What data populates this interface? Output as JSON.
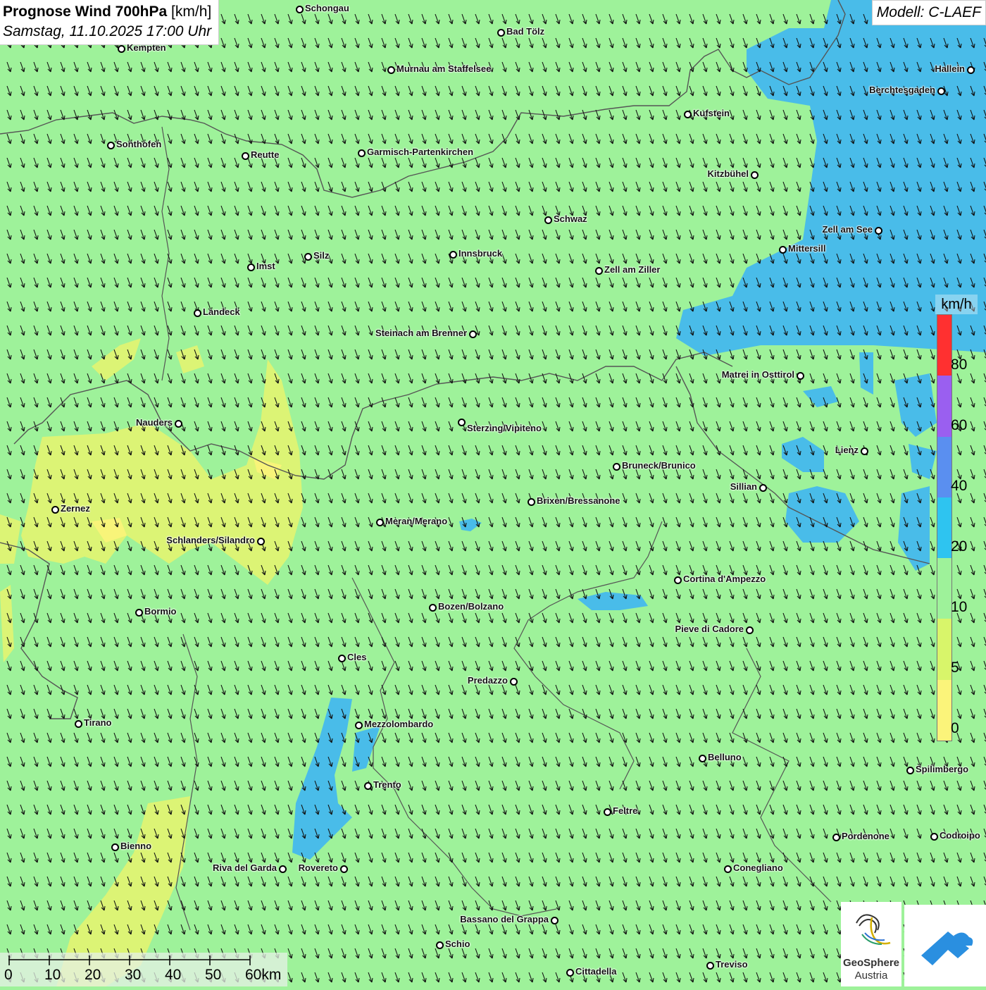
{
  "header": {
    "title_bold": "Prognose Wind 700hPa",
    "title_unit": " [km/h]",
    "datetime": "Samstag, 11.10.2025 17:00 Uhr",
    "model": "Modell: C-LAEF"
  },
  "legend": {
    "unit": "km/h",
    "labels": [
      "80",
      "60",
      "40",
      "20",
      "10",
      "5",
      "0"
    ],
    "colors": [
      "#ff3030",
      "#9a5ff0",
      "#5a8ff0",
      "#2ec4f0",
      "#9ef29a",
      "#d8f56a",
      "#fbf47a"
    ]
  },
  "scale_bar": {
    "labels": [
      "0",
      "10",
      "20",
      "30",
      "40",
      "50",
      "60km"
    ]
  },
  "logo": {
    "line1": "GeoSphere",
    "line2": "Austria"
  },
  "cities": [
    {
      "name": "Schongau"
    },
    {
      "name": "Bad Tölz"
    },
    {
      "name": "Kempten"
    },
    {
      "name": "Murnau am Staffelsee"
    },
    {
      "name": "Hallein"
    },
    {
      "name": "Berchtesgaden"
    },
    {
      "name": "Kufstein"
    },
    {
      "name": "Sonthofen"
    },
    {
      "name": "Reutte"
    },
    {
      "name": "Garmisch-Partenkirchen"
    },
    {
      "name": "Kitzbühel"
    },
    {
      "name": "Schwaz"
    },
    {
      "name": "Zell am See"
    },
    {
      "name": "Mittersill"
    },
    {
      "name": "Innsbruck"
    },
    {
      "name": "Silz"
    },
    {
      "name": "Imst"
    },
    {
      "name": "Zell am Ziller"
    },
    {
      "name": "Landeck"
    },
    {
      "name": "Steinach am Brenner"
    },
    {
      "name": "Matrei in Osttirol"
    },
    {
      "name": "Nauders"
    },
    {
      "name": "Sterzing/Vipiteno"
    },
    {
      "name": "Lienz"
    },
    {
      "name": "Bruneck/Brunico"
    },
    {
      "name": "Sillian"
    },
    {
      "name": "Zernez"
    },
    {
      "name": "Brixen/Bressanone"
    },
    {
      "name": "Meran/Merano"
    },
    {
      "name": "Schlanders/Silandro"
    },
    {
      "name": "Cortina d'Ampezzo"
    },
    {
      "name": "Bozen/Bolzano"
    },
    {
      "name": "Bormio"
    },
    {
      "name": "Pieve di Cadore"
    },
    {
      "name": "Cles"
    },
    {
      "name": "Predazzo"
    },
    {
      "name": "Tirano"
    },
    {
      "name": "Mezzolombardo"
    },
    {
      "name": "Belluno"
    },
    {
      "name": "Spilimbergo"
    },
    {
      "name": "Trento"
    },
    {
      "name": "Feltre"
    },
    {
      "name": "Pordenone"
    },
    {
      "name": "Codroipo"
    },
    {
      "name": "Bienno"
    },
    {
      "name": "Riva del Garda"
    },
    {
      "name": "Rovereto"
    },
    {
      "name": "Conegliano"
    },
    {
      "name": "Bassano del Grappa"
    },
    {
      "name": "Schio"
    },
    {
      "name": "Treviso"
    },
    {
      "name": "Cittadella"
    }
  ]
}
